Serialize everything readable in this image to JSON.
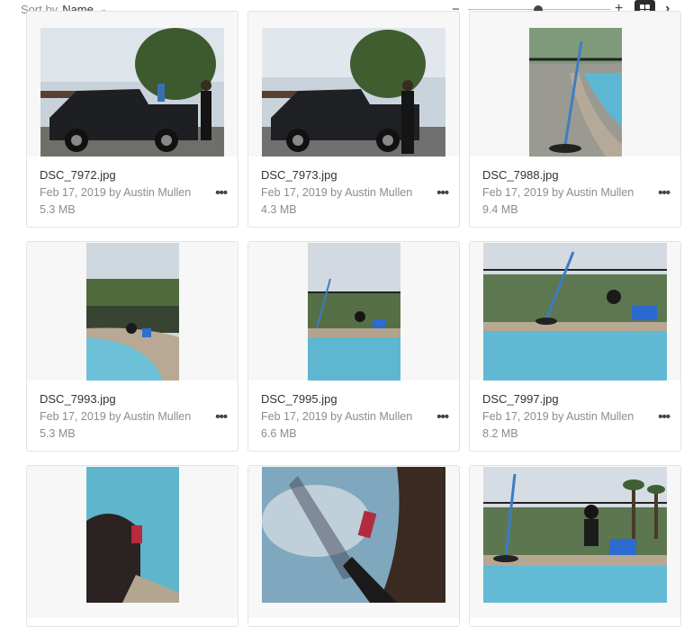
{
  "toolbar": {
    "sort_label": "Sort by",
    "sort_value": "Name",
    "zoom_minus": "−",
    "zoom_plus": "+",
    "next": "›"
  },
  "files": [
    {
      "name": "DSC_7972.jpg",
      "meta": "Feb 17, 2019 by Austin Mullen",
      "size": "5.3 MB"
    },
    {
      "name": "DSC_7973.jpg",
      "meta": "Feb 17, 2019 by Austin Mullen",
      "size": "4.3 MB"
    },
    {
      "name": "DSC_7988.jpg",
      "meta": "Feb 17, 2019 by Austin Mullen",
      "size": "9.4 MB"
    },
    {
      "name": "DSC_7993.jpg",
      "meta": "Feb 17, 2019 by Austin Mullen",
      "size": "5.3 MB"
    },
    {
      "name": "DSC_7995.jpg",
      "meta": "Feb 17, 2019 by Austin Mullen",
      "size": "6.6 MB"
    },
    {
      "name": "DSC_7997.jpg",
      "meta": "Feb 17, 2019 by Austin Mullen",
      "size": "8.2 MB"
    },
    {
      "name": "",
      "meta": "",
      "size": ""
    },
    {
      "name": "",
      "meta": "",
      "size": ""
    },
    {
      "name": "",
      "meta": "",
      "size": ""
    }
  ],
  "more_label": "•••"
}
